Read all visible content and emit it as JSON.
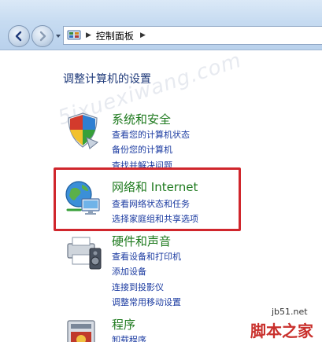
{
  "address": {
    "breadcrumb": "控制面板"
  },
  "heading": "调整计算机的设置",
  "watermark": "5ixuexiwang.com",
  "categories": [
    {
      "title": "系统和安全",
      "links": [
        "查看您的计算机状态",
        "备份您的计算机",
        "查找并解决问题"
      ]
    },
    {
      "title": "网络和 Internet",
      "links": [
        "查看网络状态和任务",
        "选择家庭组和共享选项"
      ]
    },
    {
      "title": "硬件和声音",
      "links": [
        "查看设备和打印机",
        "添加设备",
        "连接到投影仪",
        "调整常用移动设置"
      ]
    },
    {
      "title": "程序",
      "links": [
        "卸载程序"
      ]
    }
  ],
  "site": {
    "domain": "jb51.net",
    "brand": "脚本之家"
  },
  "colors": {
    "category_title": "#1e7a1e",
    "link": "#1a3aa0",
    "heading": "#1f3a7a",
    "highlight_border": "#d0262c"
  }
}
